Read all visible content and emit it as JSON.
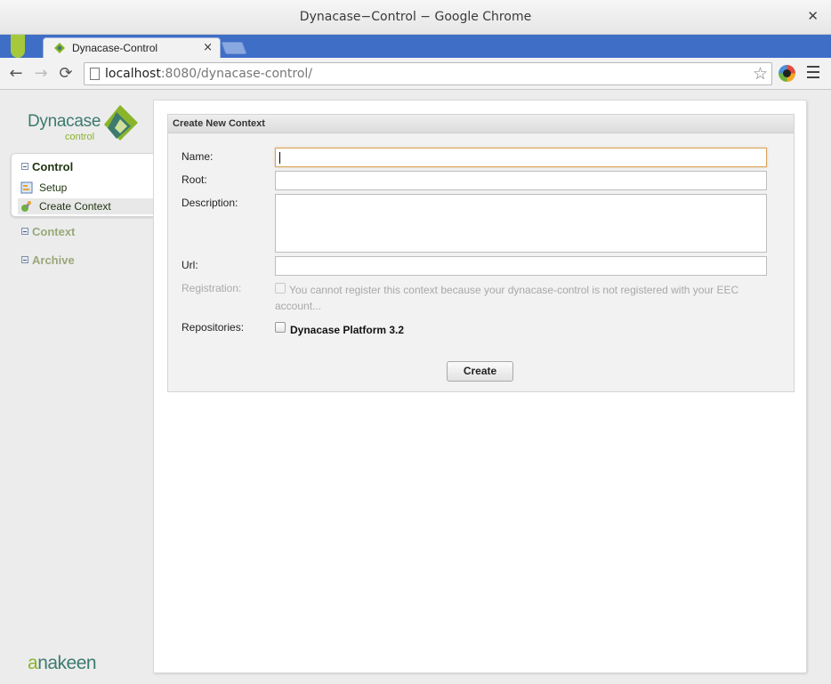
{
  "window": {
    "title": "Dynacase−Control − Google Chrome",
    "close_glyph": "✕"
  },
  "browser": {
    "tab": {
      "label": "Dynacase-Control",
      "close_glyph": "×"
    },
    "back_glyph": "←",
    "forward_glyph": "→",
    "reload_glyph": "⟳",
    "url_host": "localhost",
    "url_rest": ":8080/dynacase-control/",
    "star_glyph": "☆",
    "icons": {
      "favicon": "dynacase-favicon-icon",
      "page": "page-icon",
      "extension": "extension-icon",
      "menu": "hamburger-menu-icon"
    }
  },
  "sidebar": {
    "logo": {
      "word": "Dynacase",
      "sub": "control"
    },
    "control": {
      "title": "Control",
      "items": [
        {
          "label": "Setup",
          "icon": "setup-icon"
        },
        {
          "label": "Create Context",
          "icon": "create-context-icon"
        }
      ]
    },
    "context_title": "Context",
    "archive_title": "Archive",
    "brand_a": "a",
    "brand_rest": "nakeen"
  },
  "form": {
    "title": "Create New Context",
    "labels": {
      "name": "Name:",
      "root": "Root:",
      "description": "Description:",
      "url": "Url:",
      "registration": "Registration:",
      "repositories": "Repositories:"
    },
    "values": {
      "name": "",
      "root": "",
      "description": "",
      "url": ""
    },
    "registration_text": "You cannot register this context because your dynacase-control is not registered with your EEC account...",
    "repository": {
      "label": "Dynacase Platform 3.2",
      "checked": false
    },
    "create_button": "Create"
  },
  "colors": {
    "tab_strip": "#3f6ec7",
    "brand_teal": "#3c7a6e",
    "brand_green": "#8ab42a",
    "focus_border": "#d8a35a"
  }
}
